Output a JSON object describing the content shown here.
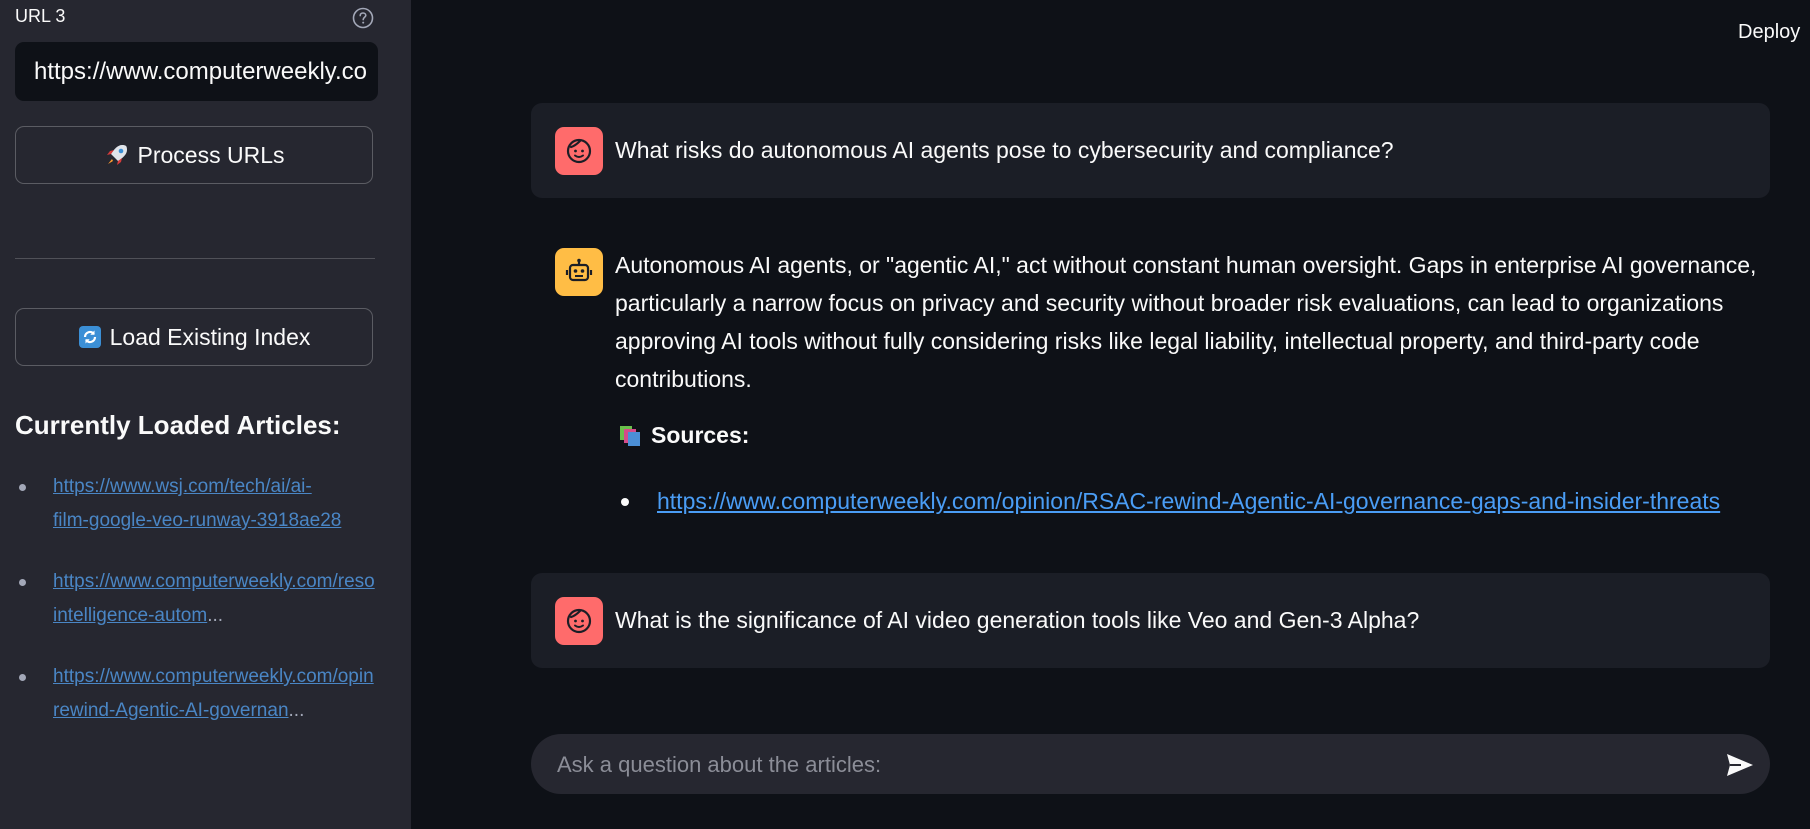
{
  "sidebar": {
    "url_field_label": "URL 3",
    "url_field_value": "https://www.computerweekly.co",
    "process_button": {
      "icon": "rocket-icon",
      "label": "Process URLs"
    },
    "load_button": {
      "icon": "refresh-icon",
      "label": "Load Existing Index"
    },
    "articles_heading": "Currently Loaded Articles:",
    "articles": [
      {
        "line1": "https://www.wsj.com/tech/ai/ai-",
        "line2": "film-google-veo-runway-3918ae28",
        "ellipsis": ""
      },
      {
        "line1": "https://www.computerweekly.com/reso",
        "line2": "intelligence-autom",
        "ellipsis": "..."
      },
      {
        "line1": "https://www.computerweekly.com/opin",
        "line2": "rewind-Agentic-AI-governan",
        "ellipsis": "..."
      }
    ]
  },
  "header": {
    "deploy_label": "Deploy"
  },
  "chat": {
    "messages": [
      {
        "role": "user",
        "text": "What risks do autonomous AI agents pose to cybersecurity and compliance?"
      },
      {
        "role": "assistant",
        "text": "Autonomous AI agents, or \"agentic AI,\" act without constant human oversight. Gaps in enterprise AI governance, particularly a narrow focus on privacy and security without broader risk evaluations, can lead to organizations approving AI tools without fully considering risks like legal liability, intellectual property, and third-party code contributions.",
        "sources_label": "Sources:",
        "sources": [
          "https://www.computerweekly.com/opinion/RSAC-rewind-Agentic-AI-governance-gaps-and-insider-threats"
        ]
      },
      {
        "role": "user",
        "text": "What is the significance of AI video generation tools like Veo and Gen-3 Alpha?"
      }
    ],
    "input_placeholder": "Ask a question about the articles:"
  },
  "colors": {
    "sidebar_bg": "#262730",
    "main_bg": "#0e1117",
    "user_avatar": "#ff6b6b",
    "bot_avatar": "#ffbd45",
    "link": "#4a9df5"
  }
}
